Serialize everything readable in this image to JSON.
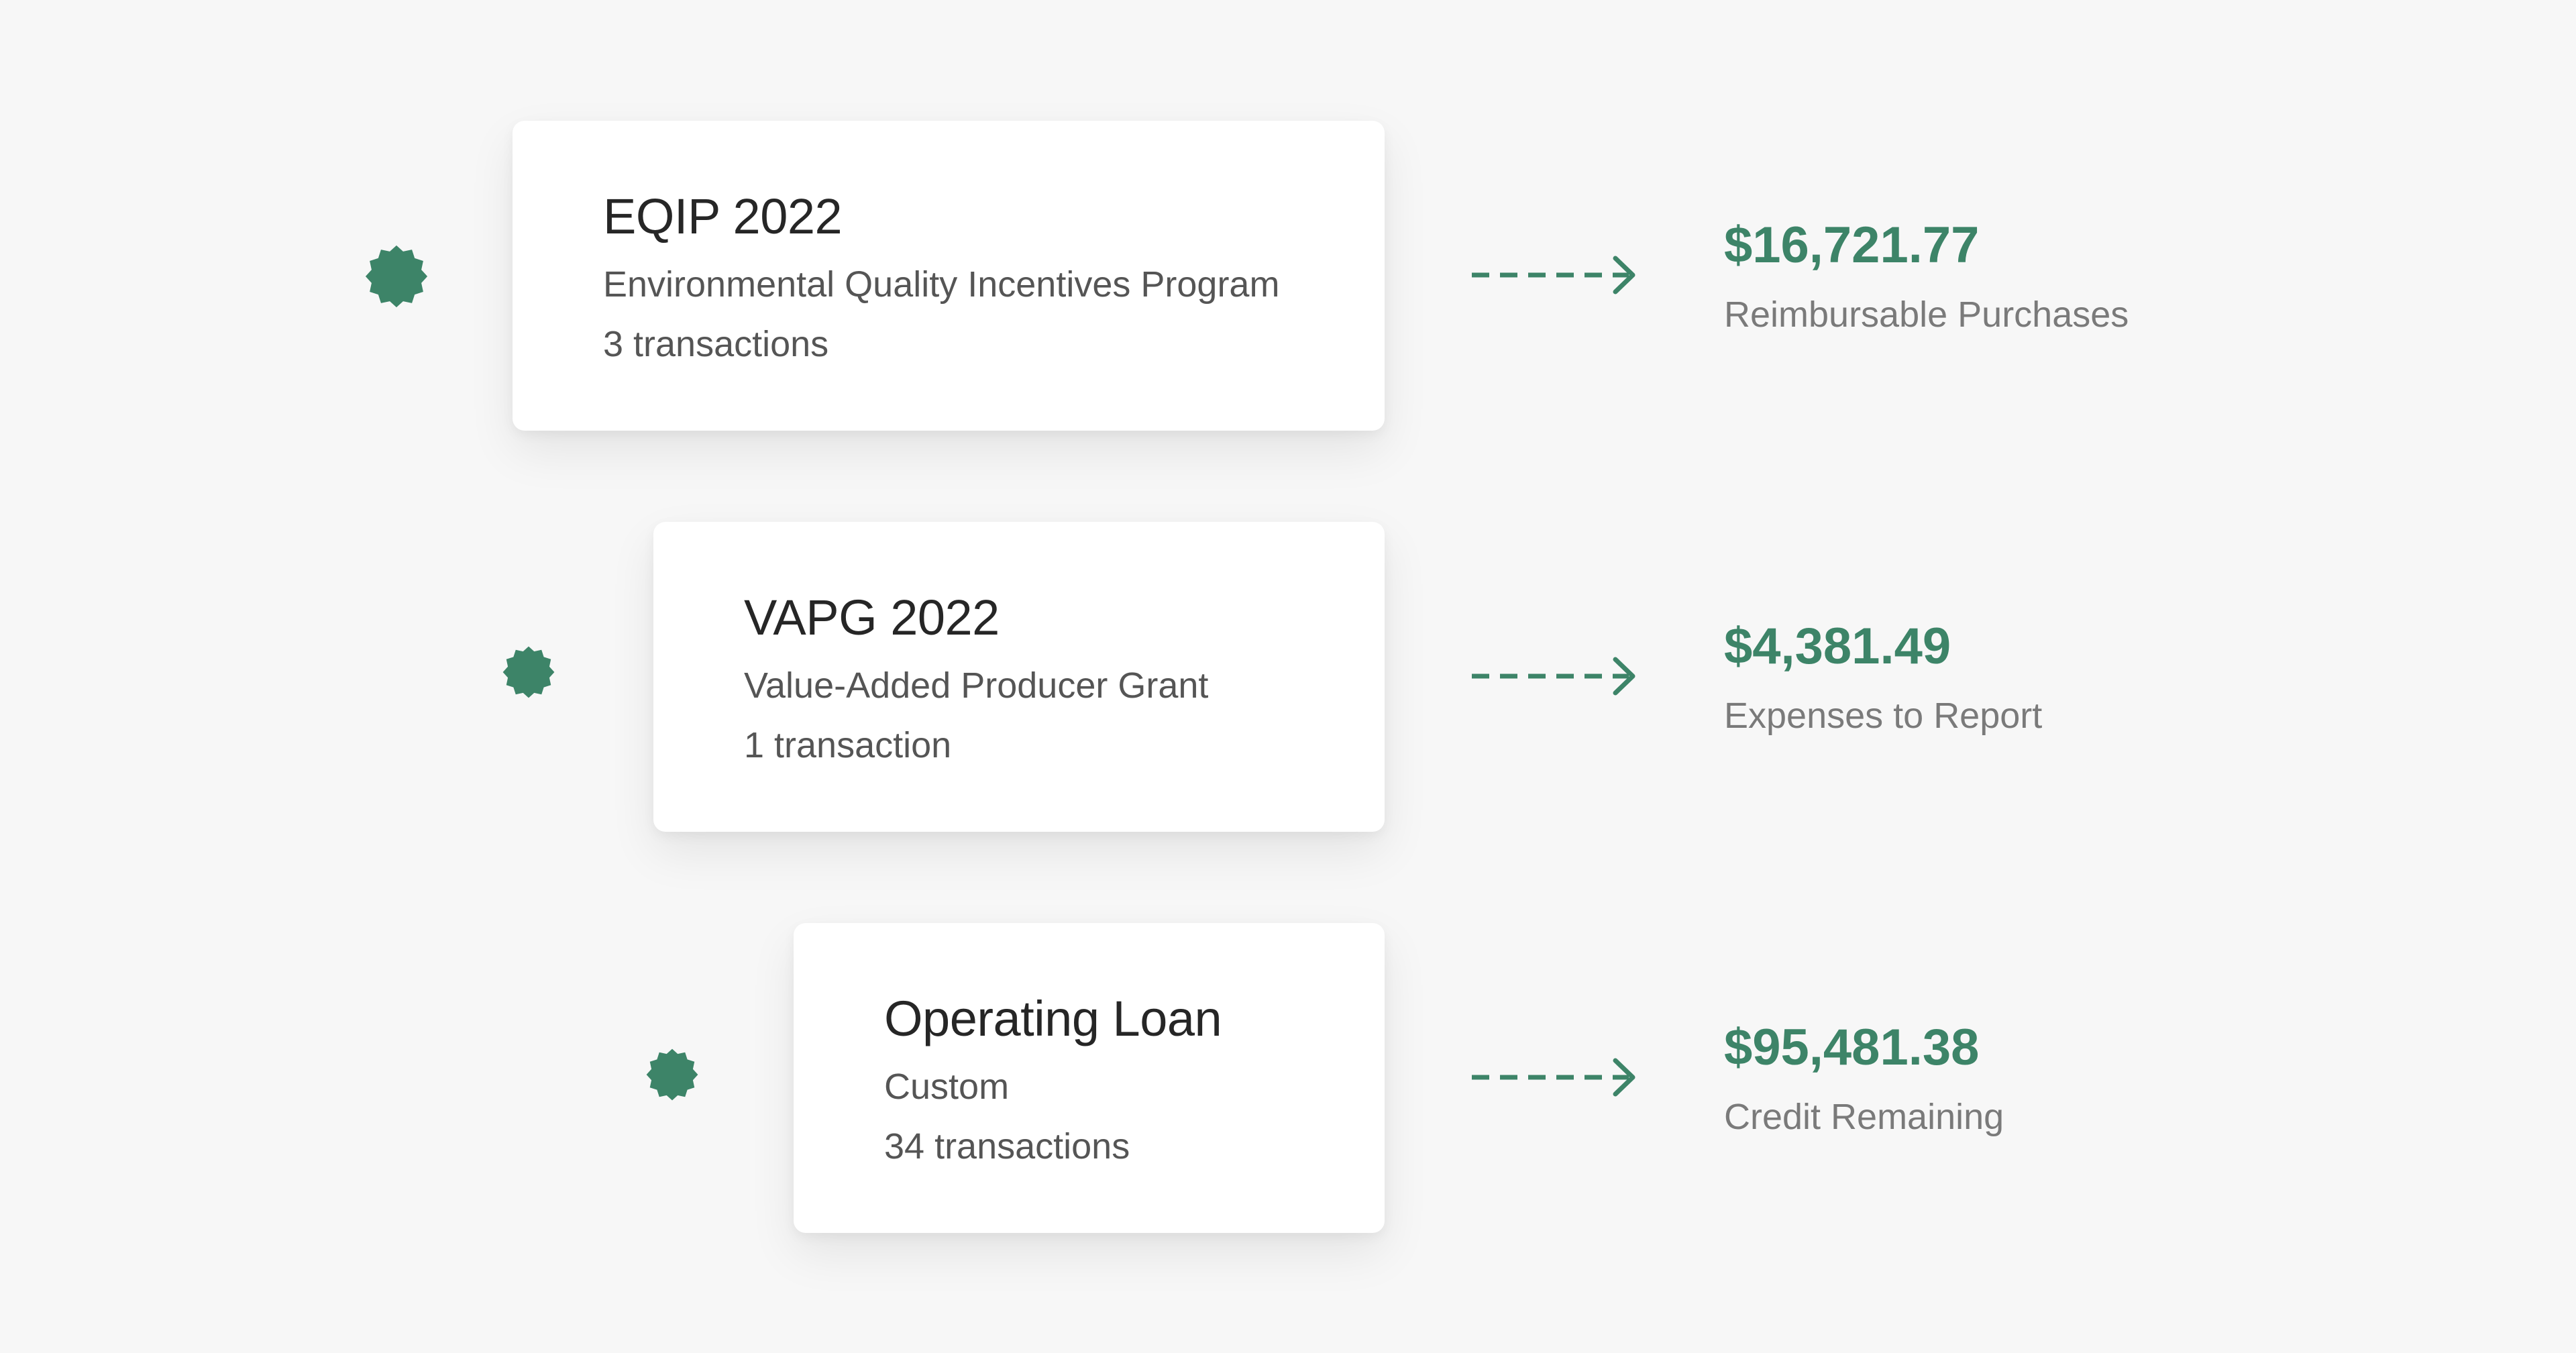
{
  "accent_color": "#3d8468",
  "programs": [
    {
      "title": "EQIP 2022",
      "subtitle": "Environmental Quality Incentives Program",
      "count": "3 transactions",
      "amount": "$16,721.77",
      "amount_label": "Reimbursable Purchases",
      "badge_icon": "starburst-icon",
      "arrow_icon": "dashed-arrow-right-icon"
    },
    {
      "title": "VAPG 2022",
      "subtitle": "Value-Added Producer Grant",
      "count": "1 transaction",
      "amount": "$4,381.49",
      "amount_label": "Expenses to Report",
      "badge_icon": "starburst-icon",
      "arrow_icon": "dashed-arrow-right-icon"
    },
    {
      "title": "Operating Loan",
      "subtitle": "Custom",
      "count": "34 transactions",
      "amount": "$95,481.38",
      "amount_label": "Credit Remaining",
      "badge_icon": "starburst-icon",
      "arrow_icon": "dashed-arrow-right-icon"
    }
  ]
}
